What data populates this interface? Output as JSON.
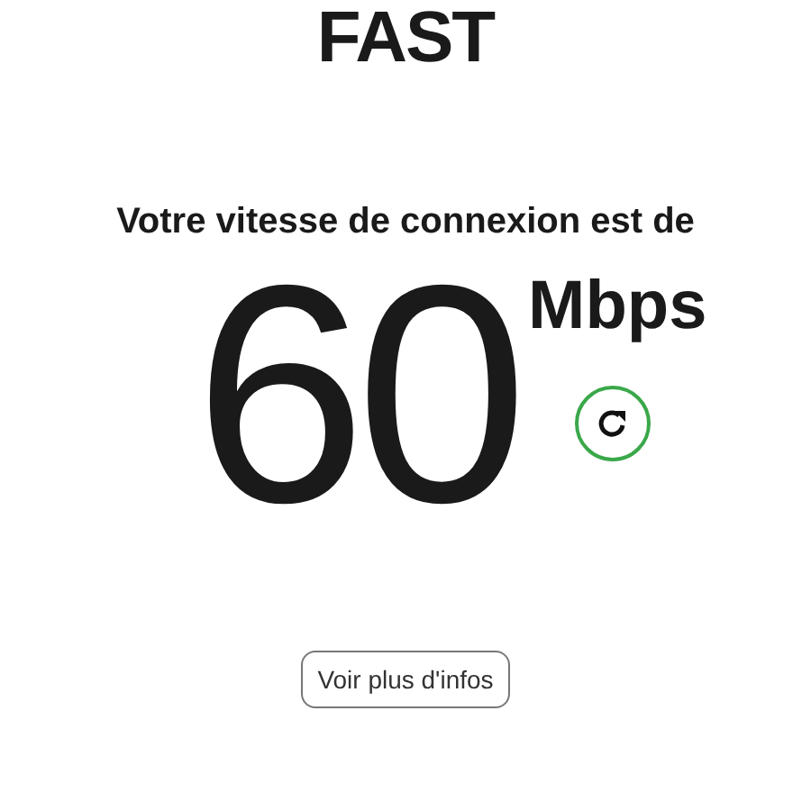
{
  "logo": "FAST",
  "heading": "Votre vitesse de connexion est de",
  "speed": {
    "value": "60",
    "unit": "Mbps"
  },
  "button": "Voir plus d'infos"
}
